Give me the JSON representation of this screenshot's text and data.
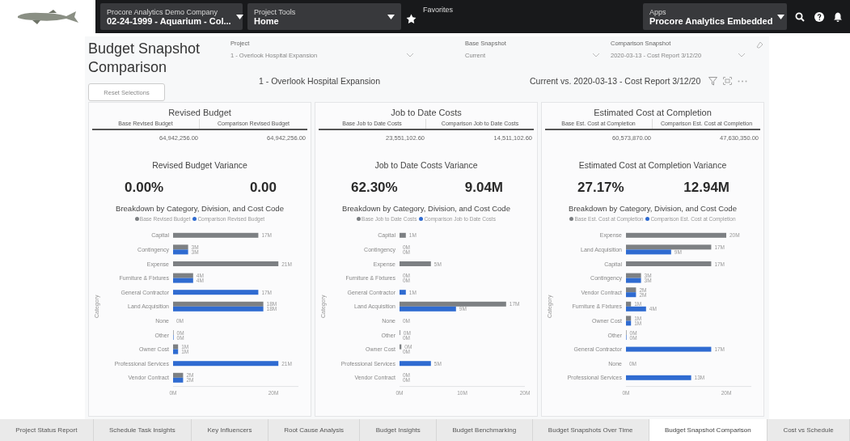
{
  "top_bar": {
    "company_label": "Procore Analytics Demo Company",
    "company_value": "02-24-1999 - Aquarium - Col...",
    "tools_label": "Project Tools",
    "tools_value": "Home",
    "favorites_label": "Favorites",
    "apps_label": "Apps",
    "apps_value": "Procore Analytics Embedded"
  },
  "report": {
    "title": "Budget Snapshot Comparison",
    "slicers": [
      {
        "label": "Project",
        "value": "1 - Overlook Hospital Expansion"
      },
      {
        "label": "Base Snapshot",
        "value": "Current"
      },
      {
        "label": "Comparison Snapshot",
        "value": "2020-03-13 - Cost Report 3/12/20"
      }
    ],
    "reset_button": "Reset Selections",
    "project_caption": "1 - Overlook Hospital Expansion",
    "comparison_caption": "Current vs. 2020-03-13 - Cost Report 3/12/20"
  },
  "panels": [
    {
      "title": "Revised Budget",
      "columns": [
        "Base Revised Budget",
        "Comparison Revised Budget"
      ],
      "values": [
        "64,942,256.00",
        "64,942,256.00"
      ],
      "variance_title": "Revised Budget Variance",
      "variance_percent": "0.00%",
      "variance_amount": "0.00",
      "chart_data": {
        "type": "bar",
        "orientation": "horizontal",
        "title": "Breakdown by Category, Division, and Cost Code",
        "ylabel": "Category",
        "categories": [
          "Capital",
          "Contingency",
          "Expense",
          "Furniture & Fixtures",
          "General Contractor",
          "Land Acquisition",
          "None",
          "Other",
          "Owner Cost",
          "Professional Services",
          "Vendor Contract"
        ],
        "xlim": [
          0,
          25
        ],
        "xticks": [
          {
            "value": 0,
            "label": "0M"
          },
          {
            "value": 20,
            "label": "20M"
          }
        ],
        "series": [
          {
            "name": "Base Revised Budget",
            "color": "#7d8083",
            "values": [
              17,
              3,
              21,
              4,
              null,
              18,
              0,
              0.1,
              1,
              null,
              2
            ],
            "value_labels": [
              "17M",
              "3M",
              "21M",
              "4M",
              null,
              "18M",
              "0M",
              "0M",
              "1M",
              null,
              "2M"
            ]
          },
          {
            "name": "Comparison Revised Budget",
            "color": "#2f6bd1",
            "values": [
              null,
              3,
              null,
              4,
              17,
              18,
              null,
              0.1,
              1,
              21,
              2
            ],
            "value_labels": [
              null,
              "3M",
              null,
              "4M",
              "17M",
              "18M",
              null,
              "0M",
              "1M",
              "21M",
              "2M"
            ]
          }
        ]
      }
    },
    {
      "title": "Job to Date Costs",
      "columns": [
        "Base Job to Date Costs",
        "Comparison Job to Date Costs"
      ],
      "values": [
        "23,551,102.60",
        "14,511,102.60"
      ],
      "variance_title": "Job to Date Costs Variance",
      "variance_percent": "62.30%",
      "variance_amount": "9.04M",
      "chart_data": {
        "type": "bar",
        "orientation": "horizontal",
        "title": "Breakdown by Category, Division, and Cost Code",
        "ylabel": "Category",
        "categories": [
          "Capital",
          "Contingency",
          "Expense",
          "Furniture & Fixtures",
          "General Contractor",
          "Land Acquisition",
          "None",
          "Other",
          "Owner Cost",
          "Professional Services",
          "Vendor Contract"
        ],
        "xlim": [
          0,
          20
        ],
        "xticks": [
          {
            "value": 0,
            "label": "0M"
          },
          {
            "value": 10,
            "label": "10M"
          },
          {
            "value": 20,
            "label": "20M"
          }
        ],
        "series": [
          {
            "name": "Base Job to Date Costs",
            "color": "#7d8083",
            "values": [
              1,
              0,
              5,
              0,
              null,
              17,
              0,
              0.1,
              0.3,
              null,
              0
            ],
            "value_labels": [
              "1M",
              "0M",
              "5M",
              "0M",
              null,
              "17M",
              "0M",
              "0M",
              "0M",
              null,
              "0M"
            ]
          },
          {
            "name": "Comparison Job to Date Costs",
            "color": "#2f6bd1",
            "values": [
              null,
              0,
              null,
              0,
              1,
              9,
              null,
              0,
              0,
              5,
              0
            ],
            "value_labels": [
              null,
              "0M",
              null,
              "0M",
              "1M",
              "9M",
              null,
              "0M",
              "0M",
              "5M",
              "0M"
            ]
          }
        ]
      }
    },
    {
      "title": "Estimated Cost at Completion",
      "columns": [
        "Base Est. Cost at Completion",
        "Comparison Est. Cost at Completion"
      ],
      "values": [
        "60,573,870.00",
        "47,630,350.00"
      ],
      "variance_title": "Estimated Cost at Completion Variance",
      "variance_percent": "27.17%",
      "variance_amount": "12.94M",
      "chart_data": {
        "type": "bar",
        "orientation": "horizontal",
        "title": "Breakdown by Category, Division, and Cost Code",
        "ylabel": "Category",
        "categories": [
          "Expense",
          "Land Acquisition",
          "Capital",
          "Contingency",
          "Vendor Contract",
          "Furniture & Fixtures",
          "Owner Cost",
          "Other",
          "General Contractor",
          "None",
          "Professional Services"
        ],
        "xlim": [
          0,
          25
        ],
        "xticks": [
          {
            "value": 0,
            "label": "0M"
          },
          {
            "value": 20,
            "label": "20M"
          }
        ],
        "series": [
          {
            "name": "Base Est. Cost at Completion",
            "color": "#7d8083",
            "values": [
              20,
              17,
              17,
              3,
              2,
              1,
              1,
              0.1,
              null,
              0,
              null
            ],
            "value_labels": [
              "20M",
              "17M",
              "17M",
              "3M",
              "2M",
              "1M",
              "1M",
              "0M",
              null,
              "0M",
              null
            ]
          },
          {
            "name": "Comparison Est. Cost at Completion",
            "color": "#2f6bd1",
            "values": [
              null,
              9,
              null,
              3,
              2,
              4,
              1,
              0.1,
              17,
              null,
              13
            ],
            "value_labels": [
              null,
              "9M",
              null,
              "3M",
              "2M",
              "4M",
              "1M",
              "0M",
              "17M",
              null,
              "13M"
            ]
          }
        ]
      }
    }
  ],
  "tabs": [
    {
      "label": "Project Status Report",
      "selected": false
    },
    {
      "label": "Schedule Task Insights",
      "selected": false
    },
    {
      "label": "Key Influencers",
      "selected": false
    },
    {
      "label": "Root Cause Analysis",
      "selected": false
    },
    {
      "label": "Budget Insights",
      "selected": false
    },
    {
      "label": "Budget Benchmarking",
      "selected": false
    },
    {
      "label": "Budget Snapshots Over Time",
      "selected": false
    },
    {
      "label": "Budget Snapshot Comparison",
      "selected": true
    },
    {
      "label": "Cost vs Schedule",
      "selected": false
    }
  ]
}
